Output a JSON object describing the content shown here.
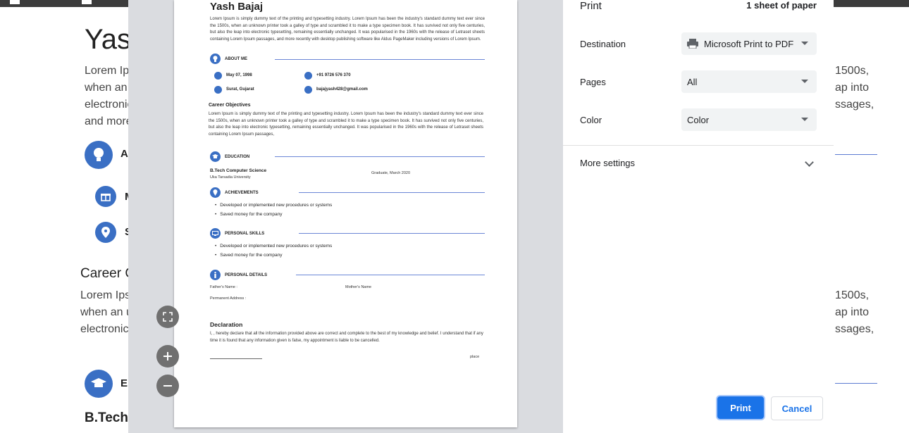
{
  "background": {
    "name": "Yash",
    "lorem_lines": [
      "Lorem Ipsum",
      "when an",
      "electronic",
      "and more"
    ],
    "lorem_right": [
      "1500s,",
      "ap into",
      "ssages,"
    ],
    "about_abbrev": "A",
    "birth_abbrev": "M",
    "city_abbrev": "S",
    "career_title": "Career C",
    "career_lines": [
      "Lorem Ipsu",
      "when an u",
      "electronic"
    ],
    "career_right": [
      "1500s,",
      "ap into",
      "ssages,"
    ],
    "edu_abbrev": "E",
    "btech": "B.Tech"
  },
  "resume": {
    "name": "Yash Bajaj",
    "intro": "Lorem Ipsum is simply dummy text of the printing and typesetting industry. Lorem Ipsum has been the industry's standard dummy text ever since the 1500s, when an unknown printer took a galley of type and scrambled it to make a type specimen book. It has survived not only five centuries, but also the leap into electronic typesetting, remaining essentially unchanged. It was popularised in the 1960s with the release of Letraset sheets containing Lorem Ipsum passages, and more recently with desktop publishing software like Aldus PageMaker including versions of Lorem Ipsum.",
    "about_label": "ABOUT ME",
    "dob": "May 07, 1998",
    "phone": "+91 9726 576 370",
    "city": "Surat, Gujarat",
    "email": "bajajyash428@gmail.com",
    "career_title": "Career Objectives",
    "career_text": "Lorem Ipsum is simply dummy text of the printing and typesetting industry. Lorem Ipsum has been the industry's standard dummy text ever since the 1500s, when an unknown printer took a galley of type and scrambled it to make a type specimen book. It has survived not only five centuries, but also the leap into electronic typesetting, remaining essentially unchanged. It was popularised in the 1960s with the release of Letraset sheets containing Lorem Ipsum passages,",
    "education_label": "EDUCATION",
    "degree": "B.Tech Computer Science",
    "university": "Uka Tarsadia University",
    "graduation": "Graduate, March 2020",
    "achievements_label": "ACHIEVEMENTS",
    "achievements": [
      "Developed or implemented new procedures or systems",
      "Saved money for the company"
    ],
    "skills_label": "PERSONAL SKILLS",
    "skills": [
      "Developed or implemented new procedures or systems",
      "Saved money for the company"
    ],
    "details_label": "PERSONAL DETAILS",
    "fathers_name": "Father's Name :",
    "mothers_name": "Mother's Name",
    "address": "Permanent Address :",
    "declaration_title": "Declaration",
    "declaration_text": "I, , hereby declare that all the information provided above are correct and complete to the best of my knowledge and belief. I understand that if any time it is found that any information given is false, my appointment is liable to be cancelled.",
    "place": "place"
  },
  "print_panel": {
    "title": "Print",
    "sheets": "1 sheet of paper",
    "destination_label": "Destination",
    "destination_value": "Microsoft Print to PDF",
    "pages_label": "Pages",
    "pages_value": "All",
    "color_label": "Color",
    "color_value": "Color",
    "more_settings": "More settings",
    "print_button": "Print",
    "cancel_button": "Cancel"
  },
  "zoom": {
    "fit_icon": "fit-to-page-icon",
    "zoom_in_icon": "zoom-in-icon",
    "zoom_out_icon": "zoom-out-icon"
  },
  "colors": {
    "accent": "#1a73e8",
    "resume_blue": "#3a6fc4"
  }
}
